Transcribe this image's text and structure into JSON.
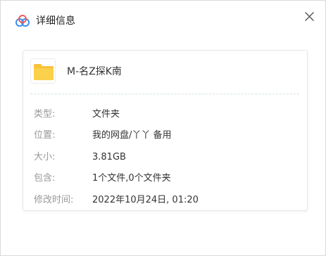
{
  "dialog": {
    "title": "详细信息",
    "logo_icon": "baidu-netdisk-logo",
    "close_icon": "close-icon"
  },
  "file": {
    "icon": "folder-icon",
    "name": "M-名Z探K南"
  },
  "details": {
    "type": {
      "label": "类型:",
      "value": "文件夹"
    },
    "location": {
      "label": "位置:",
      "value": "我的网盘/丫丫 备用"
    },
    "size": {
      "label": "大小:",
      "value": "3.81GB"
    },
    "contains": {
      "label": "包含:",
      "value": "1个文件,0个文件夹"
    },
    "modified": {
      "label": "修改时间:",
      "value": "2022年10月24日, 01:20"
    }
  },
  "colors": {
    "folder": "#f7c338",
    "logo_blue": "#3a8ff0",
    "logo_red": "#f05a5a",
    "divider": "#d2e4da"
  }
}
